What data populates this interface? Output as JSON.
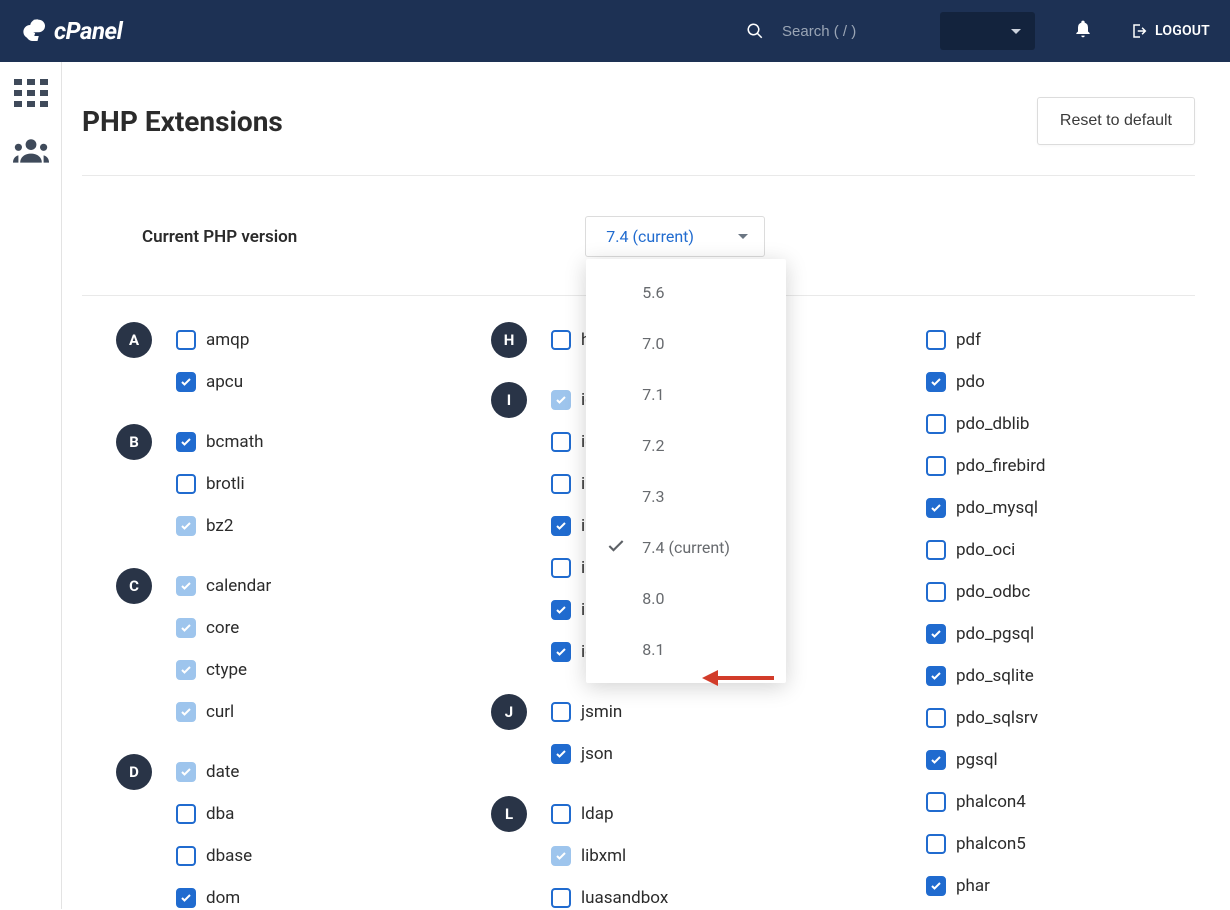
{
  "header": {
    "logo_text": "cPanel",
    "search_placeholder": "Search ( / )",
    "logout_label": "LOGOUT"
  },
  "page": {
    "title": "PHP Extensions",
    "reset_label": "Reset to default"
  },
  "version": {
    "label": "Current PHP version",
    "selected_label": "7.4 (current)",
    "options": [
      {
        "label": "5.6",
        "selected": false
      },
      {
        "label": "7.0",
        "selected": false
      },
      {
        "label": "7.1",
        "selected": false
      },
      {
        "label": "7.2",
        "selected": false
      },
      {
        "label": "7.3",
        "selected": false
      },
      {
        "label": "7.4 (current)",
        "selected": true
      },
      {
        "label": "8.0",
        "selected": false
      },
      {
        "label": "8.1",
        "selected": false
      }
    ]
  },
  "columns": [
    {
      "groups": [
        {
          "letter": "A",
          "items": [
            {
              "name": "amqp",
              "state": "off"
            },
            {
              "name": "apcu",
              "state": "on"
            }
          ]
        },
        {
          "letter": "B",
          "items": [
            {
              "name": "bcmath",
              "state": "on"
            },
            {
              "name": "brotli",
              "state": "off"
            },
            {
              "name": "bz2",
              "state": "on-light"
            }
          ]
        },
        {
          "letter": "C",
          "items": [
            {
              "name": "calendar",
              "state": "on-light"
            },
            {
              "name": "core",
              "state": "on-light"
            },
            {
              "name": "ctype",
              "state": "on-light"
            },
            {
              "name": "curl",
              "state": "on-light"
            }
          ]
        },
        {
          "letter": "D",
          "items": [
            {
              "name": "date",
              "state": "on-light"
            },
            {
              "name": "dba",
              "state": "off"
            },
            {
              "name": "dbase",
              "state": "off"
            },
            {
              "name": "dom",
              "state": "on"
            }
          ]
        }
      ]
    },
    {
      "groups": [
        {
          "letter": "H",
          "items": [
            {
              "name": "http",
              "state": "off"
            }
          ]
        },
        {
          "letter": "I",
          "items": [
            {
              "name": "iconv",
              "state": "on-light"
            },
            {
              "name": "igbinary",
              "state": "off"
            },
            {
              "name": "imagick",
              "state": "off"
            },
            {
              "name": "imap",
              "state": "on"
            },
            {
              "name": "inotify",
              "state": "off"
            },
            {
              "name": "intl",
              "state": "on"
            },
            {
              "name": "ioncube_loader",
              "state": "on"
            }
          ]
        },
        {
          "letter": "J",
          "items": [
            {
              "name": "jsmin",
              "state": "off"
            },
            {
              "name": "json",
              "state": "on"
            }
          ]
        },
        {
          "letter": "L",
          "items": [
            {
              "name": "ldap",
              "state": "off"
            },
            {
              "name": "libxml",
              "state": "on-light"
            },
            {
              "name": "luasandbox",
              "state": "off"
            }
          ]
        }
      ]
    },
    {
      "groups": [
        {
          "letter": "",
          "items": [
            {
              "name": "pdf",
              "state": "off"
            },
            {
              "name": "pdo",
              "state": "on"
            },
            {
              "name": "pdo_dblib",
              "state": "off"
            },
            {
              "name": "pdo_firebird",
              "state": "off"
            },
            {
              "name": "pdo_mysql",
              "state": "on"
            },
            {
              "name": "pdo_oci",
              "state": "off"
            },
            {
              "name": "pdo_odbc",
              "state": "off"
            },
            {
              "name": "pdo_pgsql",
              "state": "on"
            },
            {
              "name": "pdo_sqlite",
              "state": "on"
            },
            {
              "name": "pdo_sqlsrv",
              "state": "off"
            },
            {
              "name": "pgsql",
              "state": "on"
            },
            {
              "name": "phalcon4",
              "state": "off"
            },
            {
              "name": "phalcon5",
              "state": "off"
            },
            {
              "name": "phar",
              "state": "on"
            }
          ]
        }
      ]
    }
  ]
}
